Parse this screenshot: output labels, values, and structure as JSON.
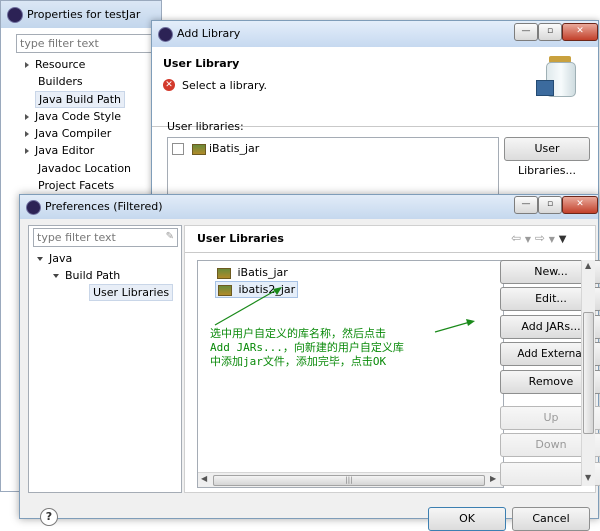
{
  "properties_window": {
    "title": "Properties for testJar",
    "filter_placeholder": "type filter text",
    "tree": [
      "Resource",
      "Builders",
      "Java Build Path",
      "Java Code Style",
      "Java Compiler",
      "Java Editor",
      "Javadoc Location",
      "Project Facets"
    ],
    "selected": "Java Build Path"
  },
  "add_library_dialog": {
    "title": "Add Library",
    "header_title": "User Library",
    "message": "Select a library.",
    "user_libraries_label": "User libraries:",
    "libraries": [
      {
        "name": "iBatis_jar",
        "checked": false
      }
    ],
    "user_libraries_button": "User Libraries..."
  },
  "preferences_dialog": {
    "title": "Preferences (Filtered)",
    "filter_placeholder": "type filter text",
    "tree": {
      "java": "Java",
      "build_path": "Build Path",
      "user_libraries": "User Libraries"
    },
    "page_title": "User Libraries",
    "libraries": [
      "iBatis_jar",
      "ibatis2_jar"
    ],
    "selected_library": "ibatis2_jar",
    "buttons": {
      "new": "New...",
      "edit": "Edit...",
      "add_jars": "Add JARs...",
      "add_external_jars": "Add External JARs...",
      "remove": "Remove",
      "up": "Up",
      "down": "Down"
    },
    "annotation": [
      "选中用户自定义的库名称，然后点击",
      "Add JARs...，向新建的用户自定义库",
      "中添加jar文件，添加完毕，点击OK"
    ],
    "ok_label": "OK",
    "cancel_label": "Cancel",
    "help_label": "?"
  },
  "colors": {
    "annotation": "#0a8a0a",
    "arrow": "#1a8a1a",
    "error": "#d33a2c"
  }
}
